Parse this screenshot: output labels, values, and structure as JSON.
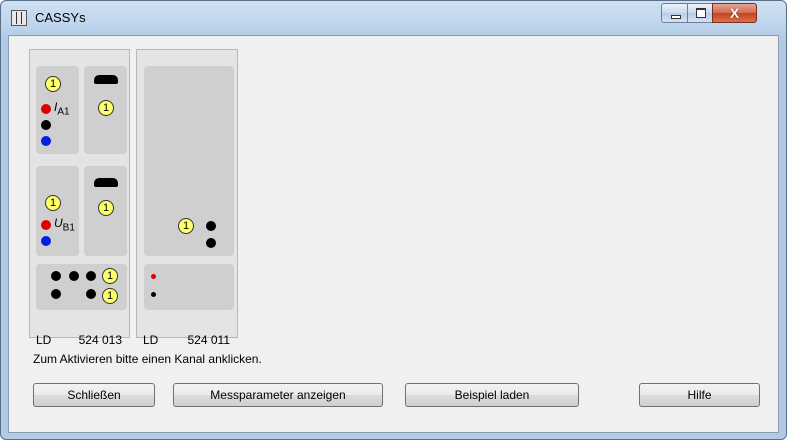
{
  "window": {
    "title": "CASSYs",
    "controls": {
      "minimize": "minimize",
      "maximize": "maximize",
      "close": "X"
    }
  },
  "modules": [
    {
      "manufacturer": "LD",
      "number": "524 013",
      "channels": [
        {
          "label": "I",
          "sub": "A1",
          "badge": "1"
        },
        {
          "label": "U",
          "sub": "B1",
          "badge": "1"
        }
      ],
      "aux_badges": [
        "1",
        "1"
      ],
      "bottom_badges": [
        "1",
        "1"
      ]
    },
    {
      "manufacturer": "LD",
      "number": "524 011",
      "badge": "1"
    }
  ],
  "hint": "Zum Aktivieren bitte einen Kanal anklicken.",
  "buttons": {
    "close": "Schließen",
    "show_params": "Messparameter anzeigen",
    "load_example": "Beispiel laden",
    "help": "Hilfe"
  },
  "colors": {
    "channel_badge": "#ffff66",
    "socket_red": "#e00000",
    "socket_blue": "#0020e0",
    "socket_black": "#000000"
  },
  "icons": [
    "cassy-app-icon",
    "minimize-icon",
    "maximize-icon",
    "close-icon"
  ]
}
